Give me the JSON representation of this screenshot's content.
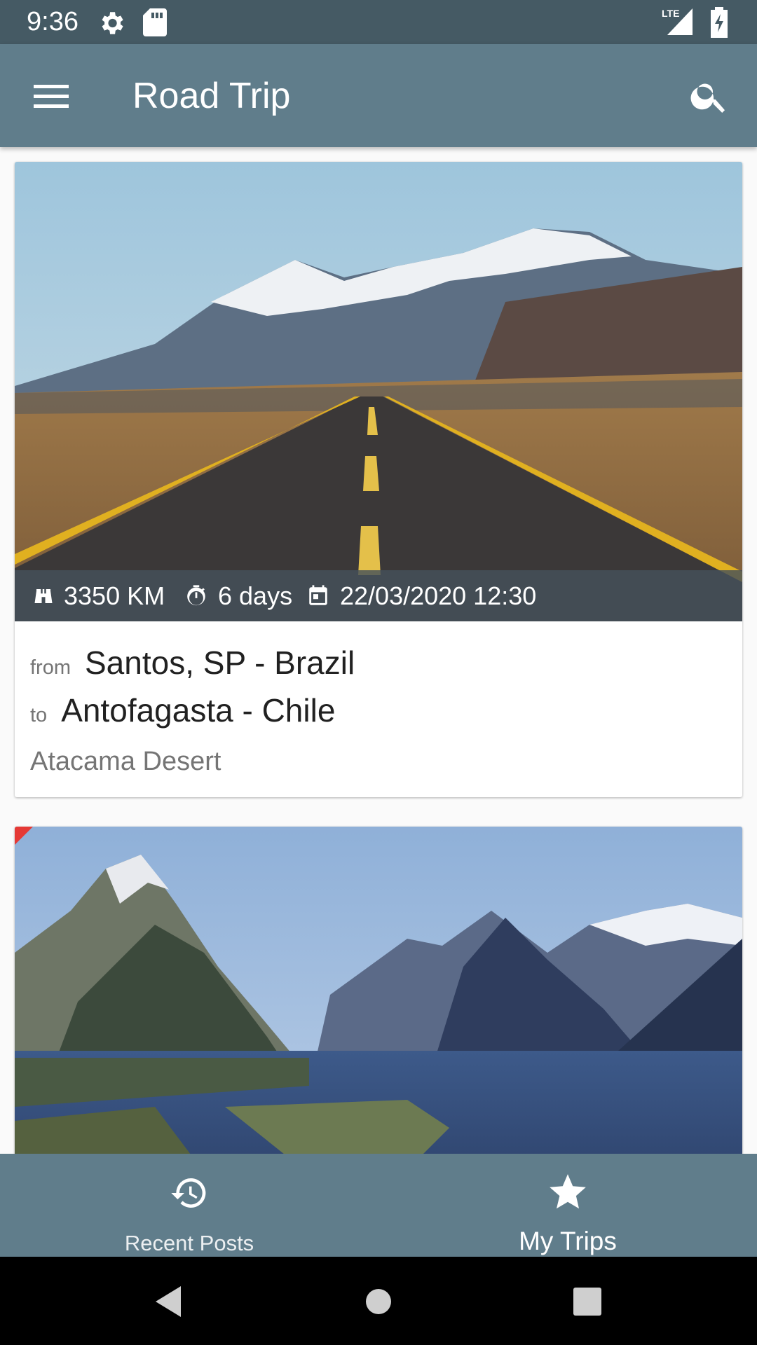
{
  "status_bar": {
    "time": "9:36",
    "network": "LTE",
    "icons": [
      "settings-icon",
      "sd-card-icon",
      "signal-icon",
      "battery-charging-icon"
    ]
  },
  "app_bar": {
    "title": "Road Trip",
    "menu_icon": "hamburger-menu-icon",
    "search_icon": "search-icon"
  },
  "trips": [
    {
      "distance": "3350 KM",
      "duration": "6 days",
      "datetime": "22/03/2020 12:30",
      "from_label": "from",
      "from": "Santos, SP - Brazil",
      "to_label": "to",
      "to": "Antofagasta - Chile",
      "subtitle": "Atacama Desert",
      "image": "desert road toward snow-capped mountains"
    },
    {
      "image": "fjord with steep mountains and reflection"
    }
  ],
  "bottom_nav": {
    "items": [
      {
        "label": "Recent Posts",
        "icon": "history-icon",
        "selected": false
      },
      {
        "label": "My Trips",
        "icon": "star-icon",
        "selected": true
      }
    ]
  },
  "colors": {
    "status_bar": "#455a64",
    "primary": "#607d8b",
    "text_primary": "#212121",
    "text_secondary": "#757575"
  }
}
